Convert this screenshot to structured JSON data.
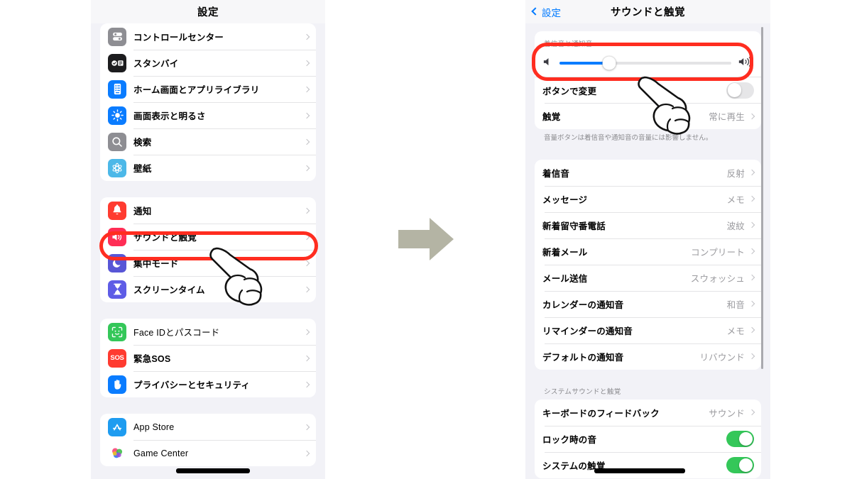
{
  "meta": {
    "accent_blue": "#007aff",
    "highlight_red": "#ff2d20",
    "toggle_green": "#34c759",
    "arrow_gray": "#b4b4a4",
    "panel_bg": "#f2f2f7",
    "card_bg": "#ffffff"
  },
  "left_panel": {
    "nav": {
      "title": "設定"
    },
    "groups": [
      {
        "name": "display-group",
        "rows": [
          {
            "label": "コントロールセンター",
            "icon": "control-center-icon",
            "icon_bg": "#8e8e93"
          },
          {
            "label": "スタンバイ",
            "icon": "standby-icon",
            "icon_bg": "#1c1c1e"
          },
          {
            "label": "ホーム画面とアプリライブラリ",
            "icon": "home-screen-icon",
            "icon_bg": "#0a7cff"
          },
          {
            "label": "画面表示と明るさ",
            "icon": "brightness-icon",
            "icon_bg": "#0a7cff"
          },
          {
            "label": "検索",
            "icon": "search-icon",
            "icon_bg": "#8e8e93"
          },
          {
            "label": "壁紙",
            "icon": "wallpaper-icon",
            "icon_bg": "#4cb8e8"
          }
        ]
      },
      {
        "name": "notifications-group",
        "rows": [
          {
            "label": "通知",
            "icon": "bell-icon",
            "icon_bg": "#ff3b30"
          },
          {
            "label": "サウンドと触覚",
            "icon": "speaker-icon",
            "icon_bg": "#ff2d55",
            "highlighted": true
          },
          {
            "label": "集中モード",
            "icon": "moon-icon",
            "icon_bg": "#5856d6"
          },
          {
            "label": "スクリーンタイム",
            "icon": "hourglass-icon",
            "icon_bg": "#5e5ce6"
          }
        ]
      },
      {
        "name": "privacy-group",
        "rows": [
          {
            "label": "Face IDとパスコード",
            "icon": "face-id-icon",
            "icon_bg": "#34c759"
          },
          {
            "label": "緊急SOS",
            "icon": "sos-icon",
            "icon_bg": "#ff3b30"
          },
          {
            "label": "プライバシーとセキュリティ",
            "icon": "hand-privacy-icon",
            "icon_bg": "#0a7cff"
          }
        ]
      },
      {
        "name": "store-group",
        "rows": [
          {
            "label": "App Store",
            "icon": "app-store-icon",
            "icon_bg": "#1e9cf0"
          },
          {
            "label": "Game Center",
            "icon": "game-center-icon",
            "icon_bg": "#ffffff",
            "redacted": true
          }
        ]
      }
    ]
  },
  "right_panel": {
    "nav": {
      "back_label": "設定",
      "title": "サウンドと触覚"
    },
    "volume_section": {
      "header": "着信音と通知音",
      "slider": {
        "value_percent": 30,
        "min_icon": "speaker-low-icon",
        "max_icon": "speaker-high-icon"
      },
      "rows": [
        {
          "label": "ボタンで変更",
          "type": "toggle",
          "on": false
        },
        {
          "label": "触覚",
          "type": "value",
          "value": "常に再生"
        }
      ],
      "footnote": "音量ボタンは着信音や通知音の音量には影響しません。"
    },
    "sounds_section": {
      "rows": [
        {
          "label": "着信音",
          "value": "反射"
        },
        {
          "label": "メッセージ",
          "value": "メモ"
        },
        {
          "label": "新着留守番電話",
          "value": "波紋"
        },
        {
          "label": "新着メール",
          "value": "コンプリート"
        },
        {
          "label": "メール送信",
          "value": "スウォッシュ"
        },
        {
          "label": "カレンダーの通知音",
          "value": "和音"
        },
        {
          "label": "リマインダーの通知音",
          "value": "メモ"
        },
        {
          "label": "デフォルトの通知音",
          "value": "リバウンド"
        }
      ]
    },
    "system_section": {
      "header": "システムサウンドと触覚",
      "rows": [
        {
          "label": "キーボードのフィードバック",
          "type": "value",
          "value": "サウンド"
        },
        {
          "label": "ロック時の音",
          "type": "toggle",
          "on": true
        },
        {
          "label": "システムの触覚",
          "type": "toggle",
          "on": true,
          "redacted": true
        }
      ]
    }
  },
  "flow": {
    "arrow": "right-arrow-icon"
  }
}
